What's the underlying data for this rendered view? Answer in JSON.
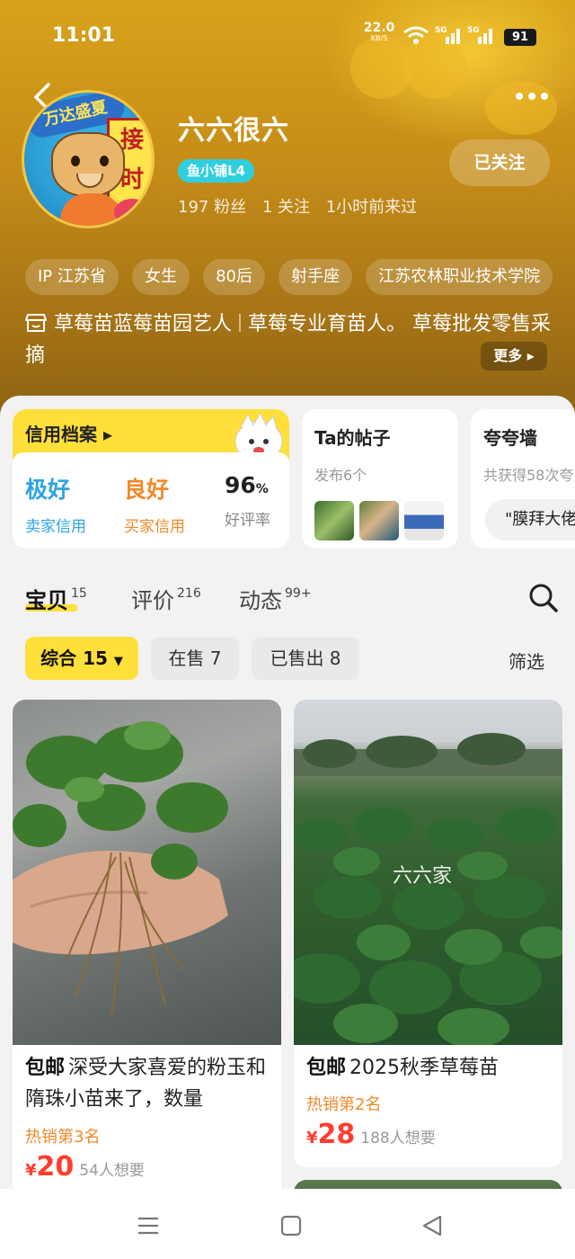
{
  "status": {
    "time": "11:01",
    "net_speed": "22.0",
    "net_unit": "KB/S",
    "net_type_1": "5G",
    "net_type_2": "5G",
    "battery": "91"
  },
  "profile": {
    "nickname": "六六很六",
    "level": "鱼小铺L4",
    "followers": "197 粉丝",
    "following": "1 关注",
    "last_seen": "1小时前来过",
    "follow_button": "已关注",
    "avatar_banner": "万达盛夏",
    "avatar_sign": "接时",
    "tags": [
      "IP 江苏省",
      "女生",
      "80后",
      "射手座",
      "江苏农林职业技术学院"
    ],
    "bio_part1": "草莓苗蓝莓苗园艺人",
    "bio_part2": "草莓专业育苗人。  草莓批发零售采摘",
    "more_button": "更多"
  },
  "credit": {
    "title": "信用档案",
    "seller_value": "极好",
    "seller_label": "卖家信用",
    "buyer_value": "良好",
    "buyer_label": "买家信用",
    "rating_value": "96",
    "rating_unit": "%",
    "rating_label": "好评率",
    "colors": {
      "seller": "#2fa3e6",
      "buyer": "#f08a2a"
    }
  },
  "posts": {
    "title": "Ta的帖子",
    "subtitle": "发布6个"
  },
  "praise": {
    "title": "夸夸墙",
    "subtitle": "共获得58次夸",
    "pill": "\"膜拜大佬\""
  },
  "tabs": [
    {
      "label": "宝贝",
      "count": "15"
    },
    {
      "label": "评价",
      "count": "216"
    },
    {
      "label": "动态",
      "count": "99+"
    }
  ],
  "filters": {
    "all": "综合 15",
    "on_sale": "在售 7",
    "sold": "已售出 8",
    "filter": "筛选"
  },
  "products": [
    {
      "free_ship": "包邮",
      "title": "深受大家喜爱的粉玉和隋珠小苗来了，数量",
      "hot": "热销第3名",
      "currency": "¥",
      "price": "20",
      "wants": "54人想要"
    },
    {
      "free_ship": "包邮",
      "title": "2025秋季草莓苗",
      "hot": "热销第2名",
      "currency": "¥",
      "price": "28",
      "wants": "188人想要",
      "watermark": "六六家"
    }
  ],
  "colors": {
    "accent": "#ffdf3a",
    "price": "#ff3d2e",
    "hot": "#f08a2a"
  }
}
